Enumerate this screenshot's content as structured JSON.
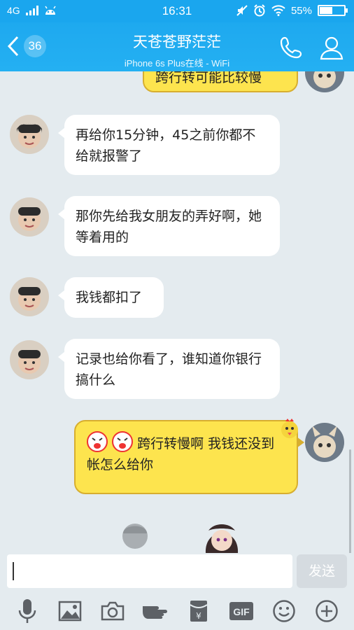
{
  "status_bar": {
    "network": "4G",
    "time": "16:31",
    "battery": "55%",
    "battery_level": 0.55
  },
  "header": {
    "back_count": "36",
    "title": "天苍苍野茫茫",
    "subtitle": "iPhone 6s Plus在线 - WiFi",
    "call_icon": "phone-icon",
    "profile_icon": "person-icon"
  },
  "messages": [
    {
      "sender": "me",
      "text": "跨行转可能比较慢"
    },
    {
      "sender": "other",
      "text": "再给你15分钟，45之前你都不给就报警了"
    },
    {
      "sender": "other",
      "text": "那你先给我女朋友的弄好啊，她等着用的"
    },
    {
      "sender": "other",
      "text": "我钱都扣了"
    },
    {
      "sender": "other",
      "text": "记录也给你看了，谁知道你银行搞什么"
    },
    {
      "sender": "me",
      "text": "跨行转慢啊 我钱还没到帐怎么给你",
      "emoji_prefix": [
        "crying-emoji-icon",
        "crying-emoji-icon"
      ]
    }
  ],
  "input": {
    "value": "",
    "send_label": "发送"
  },
  "toolbar": {
    "items": [
      "microphone-icon",
      "image-icon",
      "camera-icon",
      "hand-pointer-icon",
      "red-envelope-icon",
      "gif-icon",
      "smiley-icon",
      "plus-icon"
    ],
    "gif_label": "GIF"
  },
  "colors": {
    "accent": "#1aa6ee",
    "chat_bg": "#e4ebef",
    "my_bubble": "#fde44e",
    "my_bubble_border": "#d7ae2f",
    "other_bubble": "#ffffff"
  }
}
